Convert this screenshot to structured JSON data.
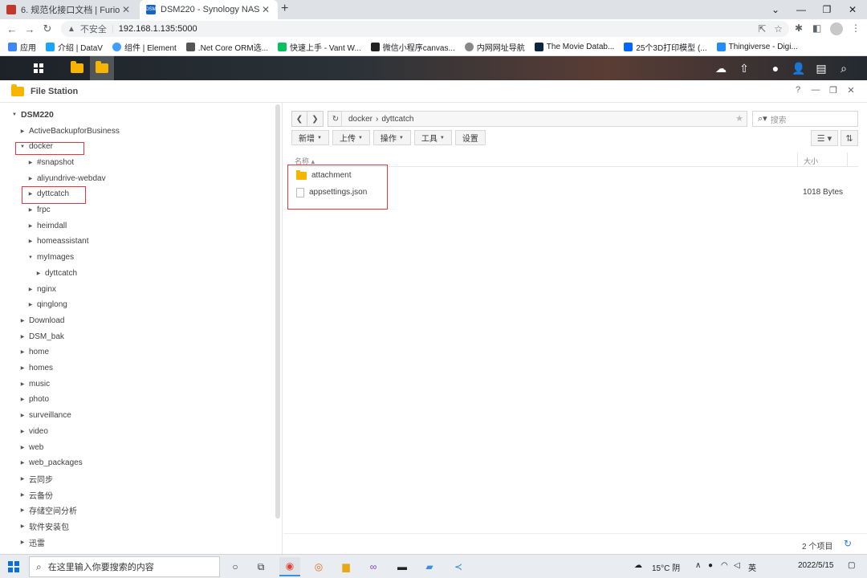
{
  "browser": {
    "tabs": [
      {
        "title": "6. 规范化接口文档 | Furion",
        "favicon_color": "#c0392b"
      },
      {
        "title": "DSM220 - Synology NAS",
        "favicon_color": "#1565c0",
        "favicon_text": "DSM"
      }
    ],
    "new_tab": "+",
    "address": {
      "security_label": "不安全",
      "url": "192.168.1.135:5000"
    },
    "bookmarks": [
      {
        "label": "应用",
        "color": "#4285f4"
      },
      {
        "label": "介绍 | DataV",
        "color": "#1aa3ff"
      },
      {
        "label": "组件 | Element",
        "color": "#409eff"
      },
      {
        "label": ".Net Core ORM选...",
        "color": "#555555"
      },
      {
        "label": "快速上手 - Vant W...",
        "color": "#07c160"
      },
      {
        "label": "微信小程序canvas...",
        "color": "#222222"
      },
      {
        "label": "内网网址导航",
        "color": "#888888"
      },
      {
        "label": "The Movie Datab...",
        "color": "#0d253f"
      },
      {
        "label": "25个3D打印模型 (...",
        "color": "#0066ff"
      },
      {
        "label": "Thingiverse - Digi...",
        "color": "#248bfb"
      }
    ]
  },
  "file_station": {
    "title": "File Station",
    "tree": {
      "root": "DSM220",
      "items": [
        {
          "label": "ActiveBackupforBusiness",
          "level": 1,
          "caret": "collapsed"
        },
        {
          "label": "docker",
          "level": 1,
          "caret": "expanded"
        },
        {
          "label": "#snapshot",
          "level": 2,
          "caret": "collapsed"
        },
        {
          "label": "aliyundrive-webdav",
          "level": 2,
          "caret": "collapsed"
        },
        {
          "label": "dyttcatch",
          "level": 2,
          "caret": "collapsed"
        },
        {
          "label": "frpc",
          "level": 2,
          "caret": "collapsed"
        },
        {
          "label": "heimdall",
          "level": 2,
          "caret": "collapsed"
        },
        {
          "label": "homeassistant",
          "level": 2,
          "caret": "collapsed"
        },
        {
          "label": "myImages",
          "level": 2,
          "caret": "expanded"
        },
        {
          "label": "dyttcatch",
          "level": 3,
          "caret": "collapsed"
        },
        {
          "label": "nginx",
          "level": 2,
          "caret": "collapsed"
        },
        {
          "label": "qinglong",
          "level": 2,
          "caret": "collapsed"
        },
        {
          "label": "Download",
          "level": 1,
          "caret": "collapsed"
        },
        {
          "label": "DSM_bak",
          "level": 1,
          "caret": "collapsed"
        },
        {
          "label": "home",
          "level": 1,
          "caret": "collapsed"
        },
        {
          "label": "homes",
          "level": 1,
          "caret": "collapsed"
        },
        {
          "label": "music",
          "level": 1,
          "caret": "collapsed"
        },
        {
          "label": "photo",
          "level": 1,
          "caret": "collapsed"
        },
        {
          "label": "surveillance",
          "level": 1,
          "caret": "collapsed"
        },
        {
          "label": "video",
          "level": 1,
          "caret": "collapsed"
        },
        {
          "label": "web",
          "level": 1,
          "caret": "collapsed"
        },
        {
          "label": "web_packages",
          "level": 1,
          "caret": "collapsed"
        },
        {
          "label": "云同步",
          "level": 1,
          "caret": "collapsed"
        },
        {
          "label": "云备份",
          "level": 1,
          "caret": "collapsed"
        },
        {
          "label": "存储空间分析",
          "level": 1,
          "caret": "collapsed"
        },
        {
          "label": "软件安装包",
          "level": 1,
          "caret": "collapsed"
        },
        {
          "label": "迅雷",
          "level": 1,
          "caret": "collapsed"
        }
      ]
    },
    "path": {
      "segments": [
        "docker",
        "dyttcatch"
      ],
      "separator": "›"
    },
    "search_placeholder": "搜索",
    "actions": {
      "create": "新增",
      "upload": "上传",
      "action": "操作",
      "tools": "工具",
      "settings": "设置"
    },
    "columns": {
      "name": "名称 ▴",
      "size": "大小"
    },
    "files": [
      {
        "name": "attachment",
        "type": "folder",
        "size": ""
      },
      {
        "name": "appsettings.json",
        "type": "file",
        "size": "1018 Bytes"
      }
    ],
    "item_count": "2 个项目",
    "help": "?"
  },
  "taskbar": {
    "search_placeholder": "在这里输入你要搜索的内容",
    "weather": "15°C 阴",
    "ime": "英",
    "date": "2022/5/15"
  }
}
